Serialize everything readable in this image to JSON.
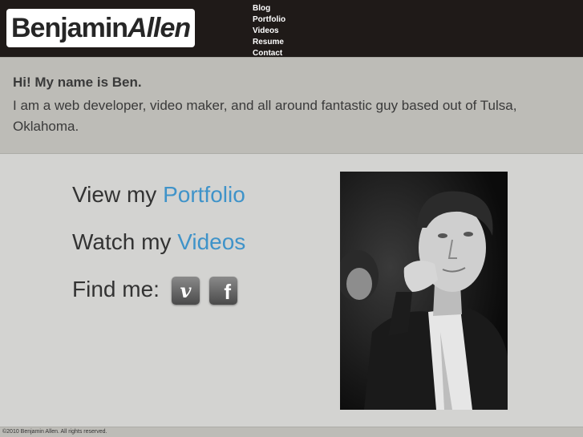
{
  "header": {
    "logo_first": "Benjamin",
    "logo_last": "Allen",
    "nav": [
      "Blog",
      "Portfolio",
      "Videos",
      "Resume",
      "Contact"
    ]
  },
  "intro": {
    "greeting": "Hi! My name is Ben.",
    "body": "I am a web developer, video maker, and all around fantastic guy based out of Tulsa, Oklahoma."
  },
  "main": {
    "portfolio_prefix": "View my ",
    "portfolio_link": "Portfolio",
    "videos_prefix": "Watch my ",
    "videos_link": "Videos",
    "find_me": "Find me:",
    "vimeo_glyph": "v",
    "facebook_glyph": "f"
  },
  "footer": {
    "copyright": "©2010 Benjamin Allen. All rights reserved."
  },
  "colors": {
    "link": "#3f93c9",
    "header_bg": "#1f1a18",
    "panel_bg": "#bdbcb7",
    "body_bg": "#d3d3d1"
  },
  "icons": [
    "vimeo-icon",
    "facebook-icon"
  ]
}
